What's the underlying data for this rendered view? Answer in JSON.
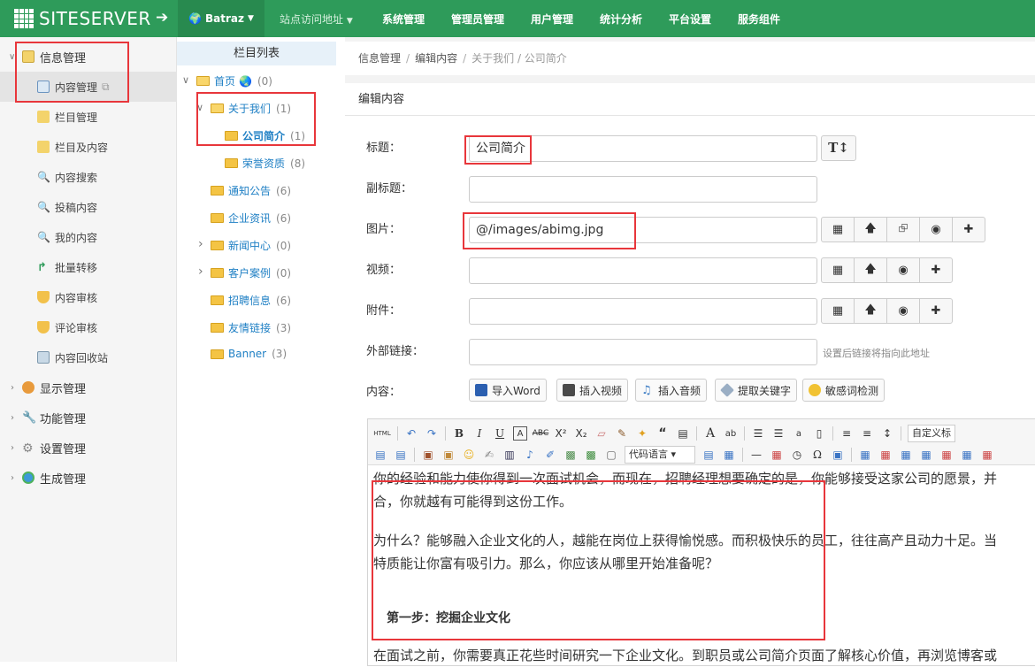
{
  "top": {
    "logo": "SITESERVER",
    "user": "Batraz",
    "nav": [
      "站点访问地址",
      "系统管理",
      "管理员管理",
      "用户管理",
      "统计分析",
      "平台设置",
      "服务组件"
    ]
  },
  "left": {
    "info": "信息管理",
    "items": [
      "内容管理",
      "栏目管理",
      "栏目及内容",
      "内容搜索",
      "投稿内容",
      "我的内容",
      "批量转移",
      "内容审核",
      "评论审核",
      "内容回收站"
    ],
    "groups": [
      "显示管理",
      "功能管理",
      "设置管理",
      "生成管理"
    ]
  },
  "tree": {
    "title": "栏目列表",
    "nodes": [
      {
        "label": "首页",
        "count": "(0)"
      },
      {
        "label": "关于我们",
        "count": "(1)"
      },
      {
        "label": "公司简介",
        "count": "(1)"
      },
      {
        "label": "荣誉资质",
        "count": "(8)"
      },
      {
        "label": "通知公告",
        "count": "(6)"
      },
      {
        "label": "企业资讯",
        "count": "(6)"
      },
      {
        "label": "新闻中心",
        "count": "(0)"
      },
      {
        "label": "客户案例",
        "count": "(0)"
      },
      {
        "label": "招聘信息",
        "count": "(6)"
      },
      {
        "label": "友情链接",
        "count": "(3)"
      },
      {
        "label": "Banner",
        "count": "(3)"
      }
    ]
  },
  "breadcrumb": {
    "a": "信息管理",
    "b": "编辑内容",
    "c": "关于我们 / 公司简介"
  },
  "form": {
    "panel_title": "编辑内容",
    "title_label": "标题：",
    "title_value": "公司简介",
    "subtitle_label": "副标题：",
    "image_label": "图片：",
    "image_value": "@/images/abimg.jpg",
    "video_label": "视频：",
    "attach_label": "附件：",
    "link_label": "外部链接：",
    "link_hint": "设置后链接将指向此地址",
    "content_label": "内容：",
    "tools": [
      "导入Word",
      "插入视频",
      "插入音频",
      "提取关键字",
      "敏感词检测"
    ]
  },
  "editor": {
    "html": "HTML",
    "custom_title": "自定义标",
    "code_lang": "代码语言",
    "p1": "你的经验和能力使你得到一次面试机会，而现在，招聘经理想要确定的是，你能够接受这家公司的愿景，并",
    "p1b": "合，你就越有可能得到这份工作。",
    "p2": "为什么？能够融入企业文化的人，越能在岗位上获得愉悦感。而积极快乐的员工，往往高产且动力十足。当",
    "p2b": "特质能让你富有吸引力。那么，你应该从哪里开始准备呢？",
    "step": "第一步：挖掘企业文化",
    "p3": "在面试之前，你需要真正花些时间研究一下企业文化。到职员或公司简介页面了解核心价值，再浏览博客或"
  }
}
